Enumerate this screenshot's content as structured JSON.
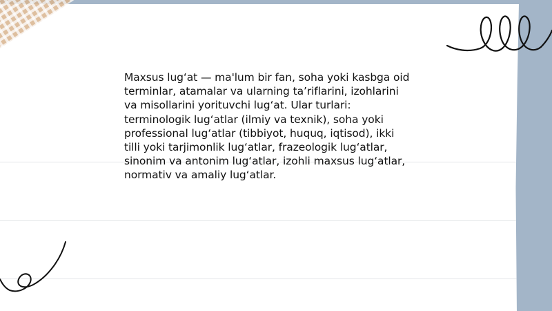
{
  "slide": {
    "body_text": "Maxsus lug‘at — ma'lum bir fan, soha yoki kasbga oid\nterminlar, atamalar va ularning ta’riflarini, izohlarini\nva misollarini yorituvchi lug‘at. Ular turlari:\nterminologik lug‘atlar (ilmiy va texnik), soha yoki\nprofessional lug‘atlar (tibbiyot, huquq, iqtisod), ikki\ntilli yoki tarjimonlik lug‘atlar, frazeologik lug‘atlar,\nsinonim va antonim lug‘atlar, izohli maxsus lug‘atlar,\nnormativ va amaliy lug‘atlar."
  },
  "decorations": {
    "background_color": "#a3b5c8",
    "paper_color": "#ffffff",
    "tape_color": "#d9b48f",
    "tape_grid_color": "#ffffff",
    "ink_color": "#111111",
    "icons": [
      "washi-tape",
      "scribble-loops-icon",
      "swirl-icon"
    ]
  }
}
